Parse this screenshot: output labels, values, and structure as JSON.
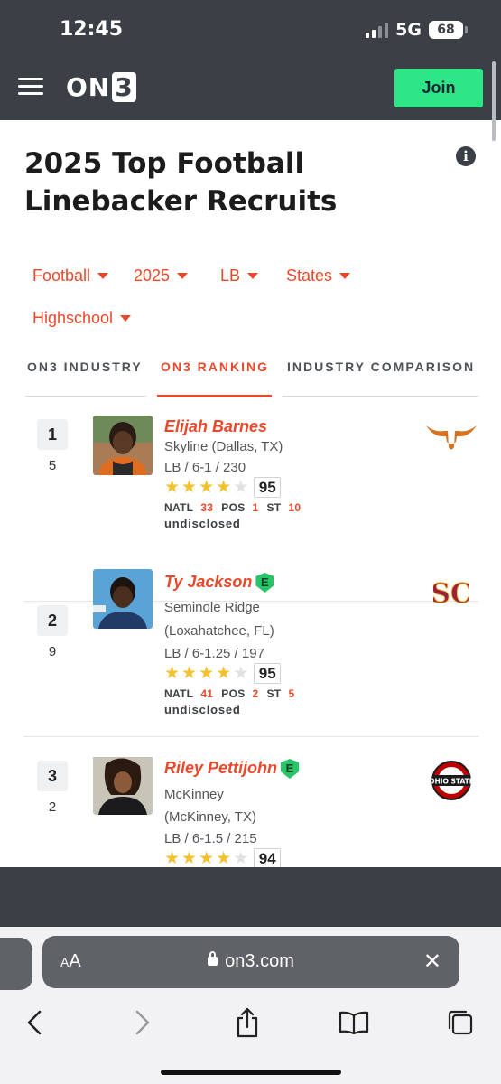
{
  "status": {
    "time": "12:45",
    "network": "5G",
    "battery": "68"
  },
  "header": {
    "logo": "ON",
    "logo_3": "3",
    "join_label": "Join"
  },
  "page": {
    "title": "2025 Top Football Linebacker Recruits"
  },
  "filters": [
    {
      "label": "Football"
    },
    {
      "label": "2025"
    },
    {
      "label": "LB"
    },
    {
      "label": "States"
    },
    {
      "label": "Highschool"
    }
  ],
  "tabs": [
    {
      "label": "ON3 INDUSTRY"
    },
    {
      "label": "ON3 RANKING"
    },
    {
      "label": "INDUSTRY COMPARISON"
    }
  ],
  "players": [
    {
      "rank": "1",
      "prev_rank": "5",
      "name": "Elijah Barnes",
      "school": "Skyline (Dallas, TX)",
      "school_2": "",
      "measurables": "LB / 6-1 / 230",
      "stars": 4,
      "rating": "95",
      "natl_label": "NATL",
      "natl": "33",
      "pos_label": "POS",
      "pos": "1",
      "st_label": "ST",
      "st": "10",
      "commit": "undisclosed",
      "team_logo": "texas-longhorns-logo",
      "elite": false
    },
    {
      "rank": "2",
      "prev_rank": "9",
      "name": "Ty Jackson",
      "school": "Seminole Ridge",
      "school_2": "(Loxahatchee, FL)",
      "measurables": "LB / 6-1.25 / 197",
      "stars": 4,
      "rating": "95",
      "natl_label": "NATL",
      "natl": "41",
      "pos_label": "POS",
      "pos": "2",
      "st_label": "ST",
      "st": "5",
      "commit": "undisclosed",
      "team_logo": "usc-trojans-logo",
      "elite": true,
      "badge": "E"
    },
    {
      "rank": "3",
      "prev_rank": "2",
      "name": "Riley Pettijohn",
      "school": "McKinney",
      "school_2": "(McKinney, TX)",
      "measurables": "LB / 6-1.5 / 215",
      "stars": 4,
      "rating": "94",
      "team_logo": "ohio-state-logo",
      "elite": true,
      "badge": "E",
      "logo_text": "OHIO STATE"
    }
  ],
  "browser": {
    "aa_small": "A",
    "aa_large": "A",
    "url": "on3.com"
  },
  "colors": {
    "accent": "#e8492b",
    "header": "#3a4045",
    "join": "#2ee587",
    "elite": "#27c468",
    "star": "#f3c02e"
  }
}
